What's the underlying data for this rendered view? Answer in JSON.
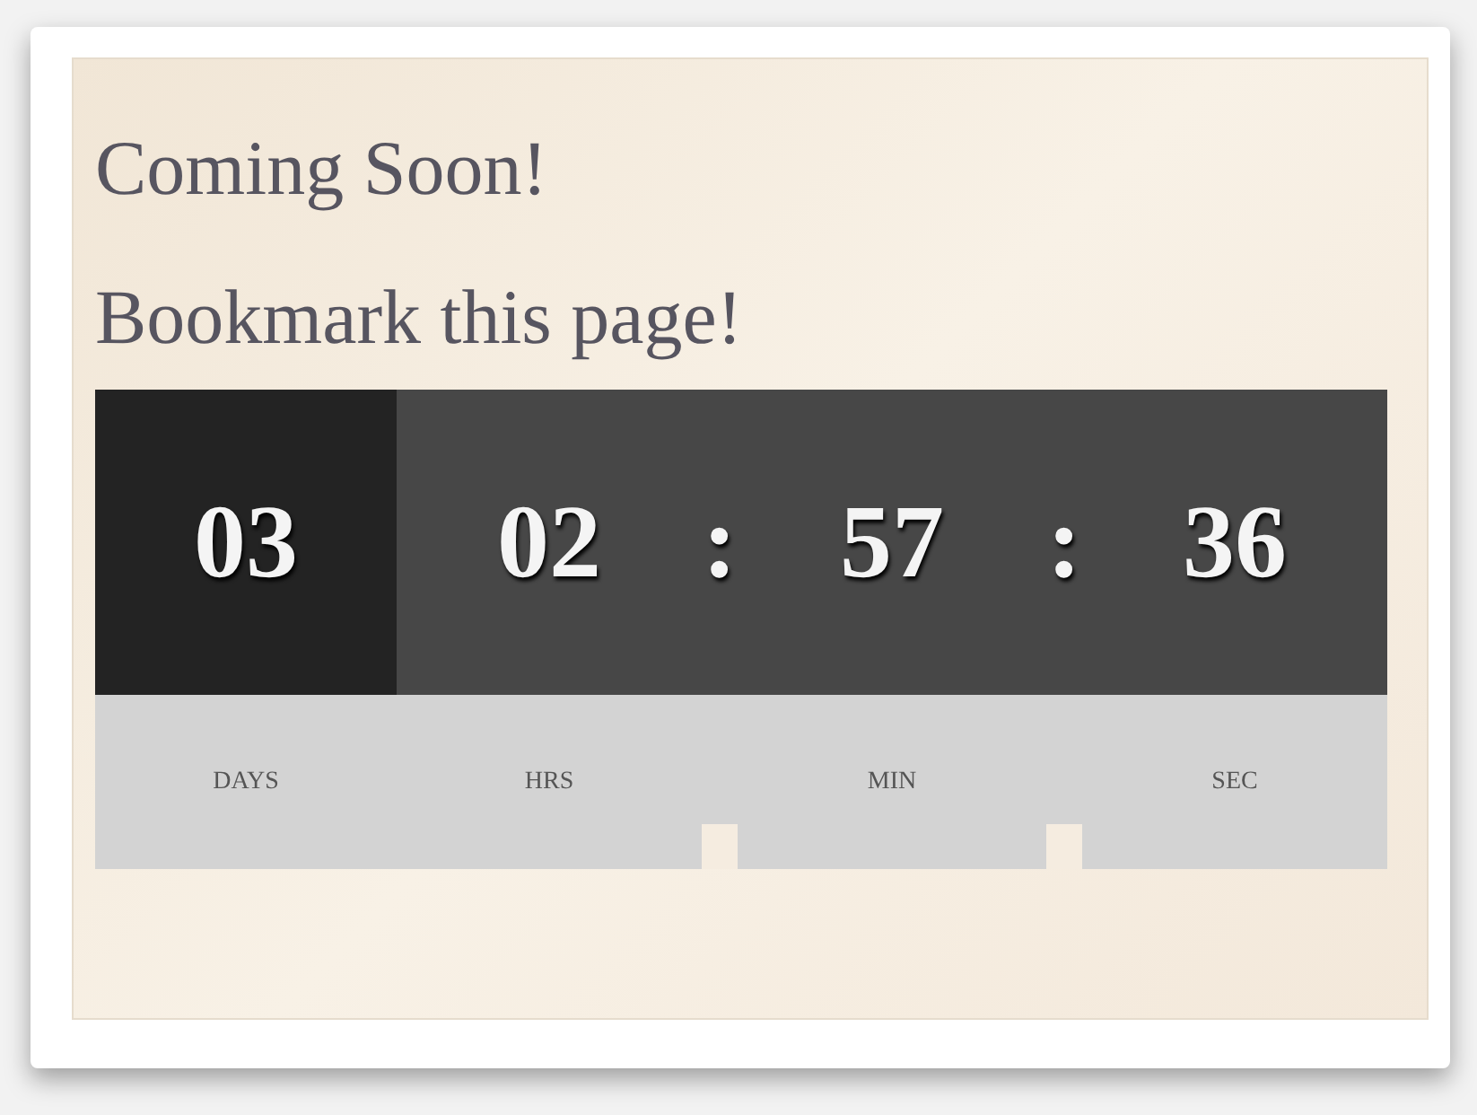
{
  "heading": [
    "Coming Soon!",
    "Bookmark this page!"
  ],
  "countdown": [
    {
      "kind": "days",
      "value": "03",
      "label": "DAYS"
    },
    {
      "kind": "time",
      "value": "02",
      "label": "HRS"
    },
    {
      "kind": "separator",
      "value": ":"
    },
    {
      "kind": "time",
      "value": "57",
      "label": "MIN"
    },
    {
      "kind": "separator",
      "value": ":"
    },
    {
      "kind": "time",
      "value": "36",
      "label": "SEC"
    }
  ]
}
